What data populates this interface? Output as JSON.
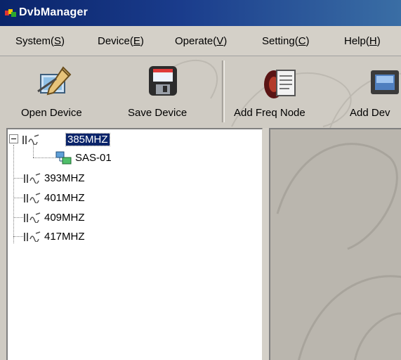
{
  "window": {
    "title": "DvbManager"
  },
  "menu": [
    {
      "label": "System(S)"
    },
    {
      "label": "Device(E)"
    },
    {
      "label": "Operate(V)"
    },
    {
      "label": "Setting(C)"
    },
    {
      "label": "Help(H)"
    }
  ],
  "toolbar": [
    {
      "label": "Open Device",
      "icon": "open-device-icon"
    },
    {
      "label": "Save Device",
      "icon": "save-device-icon"
    },
    {
      "label": "Add Freq Node",
      "icon": "add-freq-node-icon"
    },
    {
      "label": "Add Dev",
      "icon": "add-device-icon"
    }
  ],
  "tree": {
    "nodes": [
      {
        "label": "385MHZ",
        "expanded": true,
        "selected": true,
        "children": [
          {
            "label": "SAS-01"
          }
        ]
      },
      {
        "label": "393MHZ"
      },
      {
        "label": "401MHZ"
      },
      {
        "label": "409MHZ"
      },
      {
        "label": "417MHZ"
      }
    ]
  },
  "colors": {
    "title_bar": "#0a246a",
    "selection": "#0a246a",
    "chrome": "#d4d0c8"
  }
}
